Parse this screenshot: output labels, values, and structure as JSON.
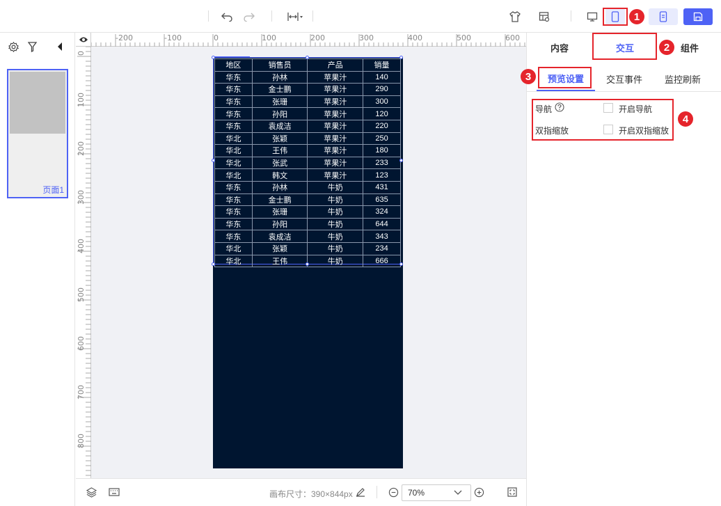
{
  "toolbar": {
    "undo_icon": "undo-icon",
    "redo_icon": "redo-icon",
    "fit_width_icon": "fit-width-icon",
    "theme_icon": "shirt-icon",
    "settings_icon": "table-settings-icon",
    "desktop_icon": "desktop-icon",
    "mobile_icon": "mobile-icon",
    "preview_icon": "preview-icon",
    "save_icon": "save-icon",
    "accent": "#4e62f5"
  },
  "badges": [
    "1",
    "2",
    "3",
    "4"
  ],
  "left_panel": {
    "page_label": "页面1"
  },
  "ruler": {
    "top": [
      "-200",
      "-100",
      "0",
      "100",
      "200",
      "300",
      "400",
      "500",
      "600"
    ],
    "left": [
      "0",
      "100",
      "200",
      "300",
      "400",
      "500",
      "600",
      "700",
      "800"
    ]
  },
  "table": {
    "headers": [
      "地区",
      "销售员",
      "产品",
      "销量"
    ],
    "rows": [
      [
        "华东",
        "孙林",
        "苹果汁",
        "140"
      ],
      [
        "华东",
        "金士鹏",
        "苹果汁",
        "290"
      ],
      [
        "华东",
        "张珊",
        "苹果汁",
        "300"
      ],
      [
        "华东",
        "孙阳",
        "苹果汁",
        "120"
      ],
      [
        "华东",
        "袁成洁",
        "苹果汁",
        "220"
      ],
      [
        "华北",
        "张颖",
        "苹果汁",
        "250"
      ],
      [
        "华北",
        "王伟",
        "苹果汁",
        "180"
      ],
      [
        "华北",
        "张武",
        "苹果汁",
        "233"
      ],
      [
        "华北",
        "韩文",
        "苹果汁",
        "123"
      ],
      [
        "华东",
        "孙林",
        "牛奶",
        "431"
      ],
      [
        "华东",
        "金士鹏",
        "牛奶",
        "635"
      ],
      [
        "华东",
        "张珊",
        "牛奶",
        "324"
      ],
      [
        "华东",
        "孙阳",
        "牛奶",
        "644"
      ],
      [
        "华东",
        "袁成洁",
        "牛奶",
        "343"
      ],
      [
        "华北",
        "张颖",
        "牛奶",
        "234"
      ],
      [
        "华北",
        "王伟",
        "牛奶",
        "666"
      ]
    ]
  },
  "bottom_bar": {
    "canvas_size": "画布尺寸：390×844px",
    "zoom": "70%"
  },
  "right_panel": {
    "tabs": [
      "内容",
      "交互",
      "组件"
    ],
    "sub_tabs": [
      "预览设置",
      "交互事件",
      "监控刷新"
    ],
    "settings": [
      {
        "label": "导航",
        "option": "开启导航",
        "checked": false
      },
      {
        "label": "双指缩放",
        "option": "开启双指缩放",
        "checked": false
      }
    ]
  }
}
